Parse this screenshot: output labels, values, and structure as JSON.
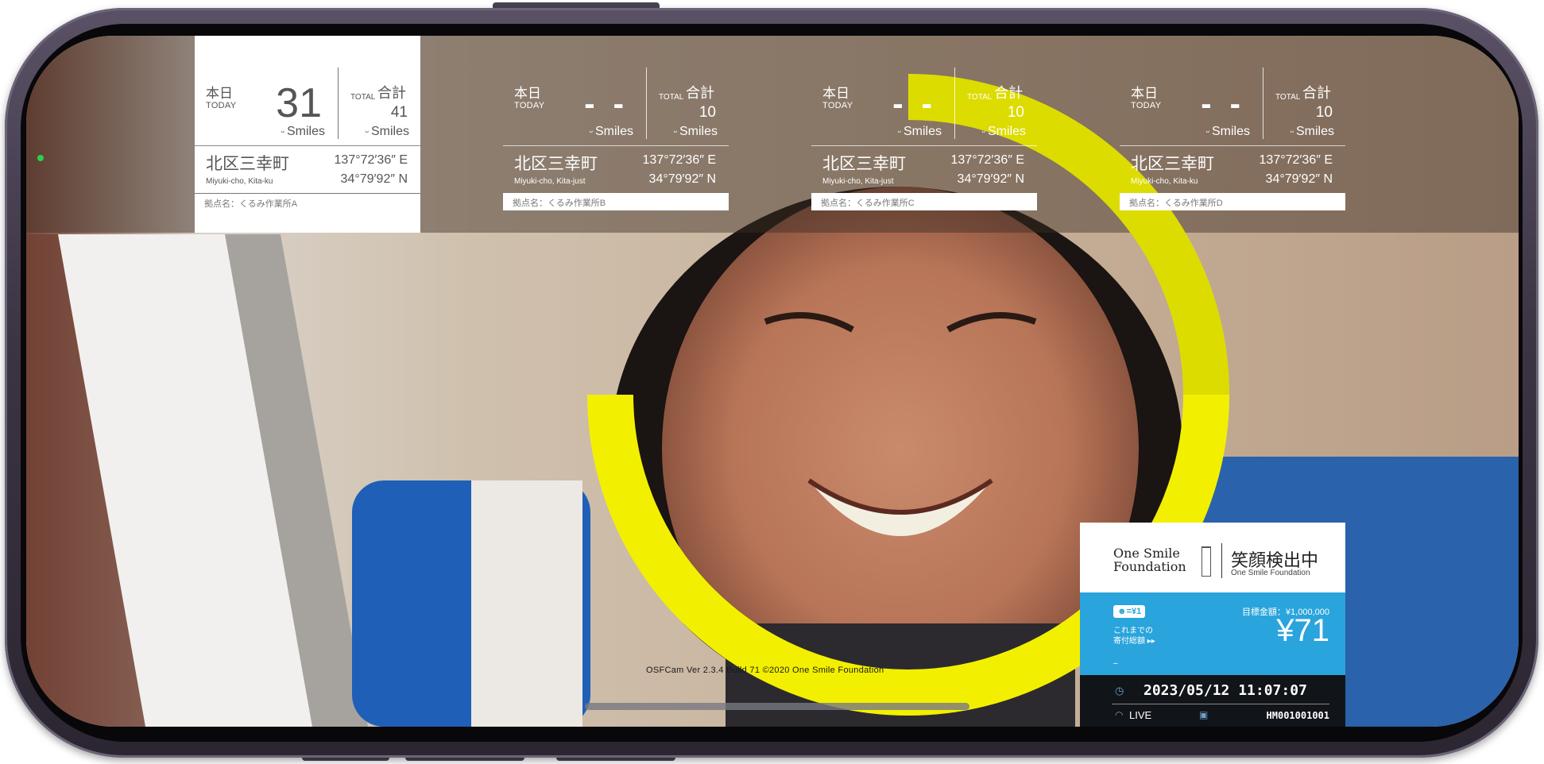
{
  "panels": [
    {
      "today_label": "本日",
      "today_label_en": "TODAY",
      "today_value": "31",
      "smiles_label": "Smiles",
      "total_label": "合計",
      "total_label_en": "TOTAL",
      "total_value": "41",
      "place": "北区三幸町",
      "place_en": "Miyuki-cho, Kita-ku",
      "longitude": "137°72′36″ E",
      "latitude": "34°79′92″ N",
      "base": "拠点名：くるみ作業所A"
    },
    {
      "today_label": "本日",
      "today_label_en": "TODAY",
      "today_value": "- -",
      "smiles_label": "Smiles",
      "total_label": "合計",
      "total_label_en": "TOTAL",
      "total_value": "10",
      "place": "北区三幸町",
      "place_en": "Miyuki-cho, Kita-just",
      "longitude": "137°72′36″ E",
      "latitude": "34°79′92″ N",
      "base": "拠点名：くるみ作業所B"
    },
    {
      "today_label": "本日",
      "today_label_en": "TODAY",
      "today_value": "- -",
      "smiles_label": "Smiles",
      "total_label": "合計",
      "total_label_en": "TOTAL",
      "total_value": "10",
      "place": "北区三幸町",
      "place_en": "Miyuki-cho, Kita-just",
      "longitude": "137°72′36″ E",
      "latitude": "34°79′92″ N",
      "base": "拠点名：くるみ作業所C"
    },
    {
      "today_label": "本日",
      "today_label_en": "TODAY",
      "today_value": "- -",
      "smiles_label": "Smiles",
      "total_label": "合計",
      "total_label_en": "TOTAL",
      "total_value": "10",
      "place": "北区三幸町",
      "place_en": "Miyuki-cho, Kita-ku",
      "longitude": "137°72′36″ E",
      "latitude": "34°79′92″ N",
      "base": "拠点名：くるみ作業所D"
    }
  ],
  "card": {
    "logo_line1": "One Smile",
    "logo_line2": "Foundation",
    "title": "笑顔検出中",
    "subtitle": "One Smile Foundation",
    "rate": "☻=¥1",
    "goal": "目標金額：¥1,000,000",
    "donation_label_1": "これまでの",
    "donation_label_2": "寄付総額 ▸▸",
    "donation_amount": "¥71",
    "dash": "–",
    "datetime": "2023/05/12  11:07:07",
    "live": "LIVE",
    "device_id": "HM001001001"
  },
  "version": "OSFCam Ver 2.3.4 Build 71 ©2020 One Smile Foundation",
  "colors": {
    "ring": "#f2f000",
    "card_blue": "#2aa4dc",
    "card_dark": "#111418",
    "frame": "#3b3443"
  },
  "icons": [
    "smile-icon",
    "clock-icon",
    "wifi-icon",
    "camera-icon"
  ]
}
